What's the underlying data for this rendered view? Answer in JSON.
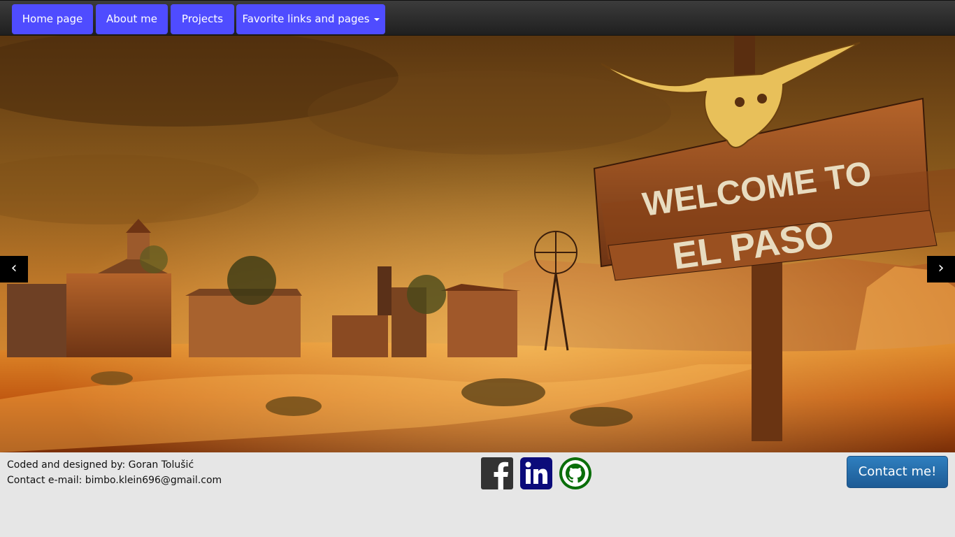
{
  "nav": {
    "items": [
      {
        "label": "Home page"
      },
      {
        "label": "About me"
      },
      {
        "label": "Projects"
      },
      {
        "label": "Favorite links and pages"
      }
    ]
  },
  "hero": {
    "sign_line1": "WELCOME TO",
    "sign_line2": "EL PASO",
    "prev_glyph": "‹",
    "next_glyph": "›"
  },
  "footer": {
    "credit_line1": "Coded and designed by: Goran Tolušić",
    "credit_line2": "Contact e-mail: bimbo.klein696@gmail.com",
    "contact_button": "Contact me!",
    "social": [
      {
        "icon": "facebook-icon",
        "color": "#333333"
      },
      {
        "icon": "linkedin-icon",
        "color": "#0b0b7a"
      },
      {
        "icon": "github-icon",
        "color": "#0a6e0a"
      }
    ]
  },
  "colors": {
    "nav_button": "#4f4cff",
    "navbar_bg": "#2a2a2a",
    "footer_bg": "#e6e6e6",
    "contact_button": "#2a72b5"
  }
}
